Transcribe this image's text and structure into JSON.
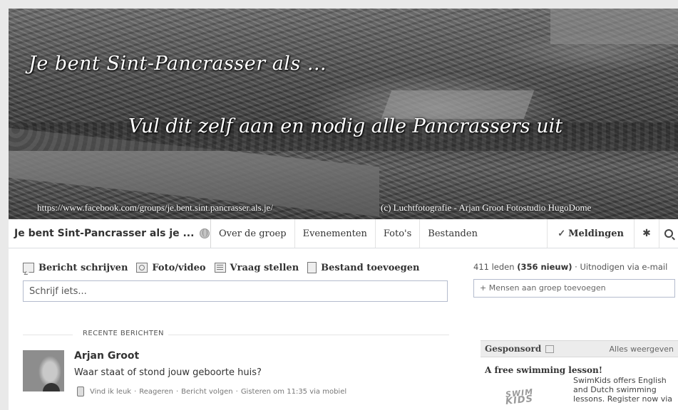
{
  "cover": {
    "title": "Je bent Sint-Pancrasser als ...",
    "subtitle": "Vul dit zelf aan en nodig alle Pancrassers uit",
    "url": "https://www.facebook.com/groups/je.bent.sint.pancrasser.als.je/",
    "credit": "(c) Luchtfotografie - Arjan Groot Fotostudio HugoDome"
  },
  "group_nav": {
    "group_name": "Je bent Sint-Pancrasser als je ...",
    "tabs": [
      {
        "label": "Over de groep"
      },
      {
        "label": "Evenementen"
      },
      {
        "label": "Foto's"
      },
      {
        "label": "Bestanden"
      }
    ],
    "notifications": "Meldingen",
    "icons": [
      "globe-icon",
      "check-icon",
      "gear-icon",
      "search-icon"
    ]
  },
  "composer": {
    "actions": [
      {
        "label": "Bericht schrijven",
        "icon": "message-icon"
      },
      {
        "label": "Foto/video",
        "icon": "photo-icon"
      },
      {
        "label": "Vraag stellen",
        "icon": "question-icon"
      },
      {
        "label": "Bestand toevoegen",
        "icon": "file-icon"
      }
    ],
    "placeholder": "Schrijf iets..."
  },
  "feed": {
    "section_label": "RECENTE BERICHTEN",
    "post": {
      "author": "Arjan Groot",
      "text": "Waar staat of stond jouw geboorte huis?",
      "like": "Vind ik leuk",
      "reply": "Reageren",
      "follow": "Bericht volgen",
      "time": "Gisteren om 11:35 via mobiel"
    }
  },
  "sidebar": {
    "members_count": "411 leden",
    "members_new": "(356 nieuw)",
    "invite": "Uitnodigen via e-mail",
    "add_people_placeholder": "+ Mensen aan groep toevoegen",
    "sponsored_label": "Gesponsord",
    "see_all": "Alles weergeven",
    "ad": {
      "title": "A free swimming lesson!",
      "logo_line1": "SWIM",
      "logo_line2": "KIDS",
      "text": "SwimKids offers English and Dutch swimming lessons. Register now via"
    }
  }
}
